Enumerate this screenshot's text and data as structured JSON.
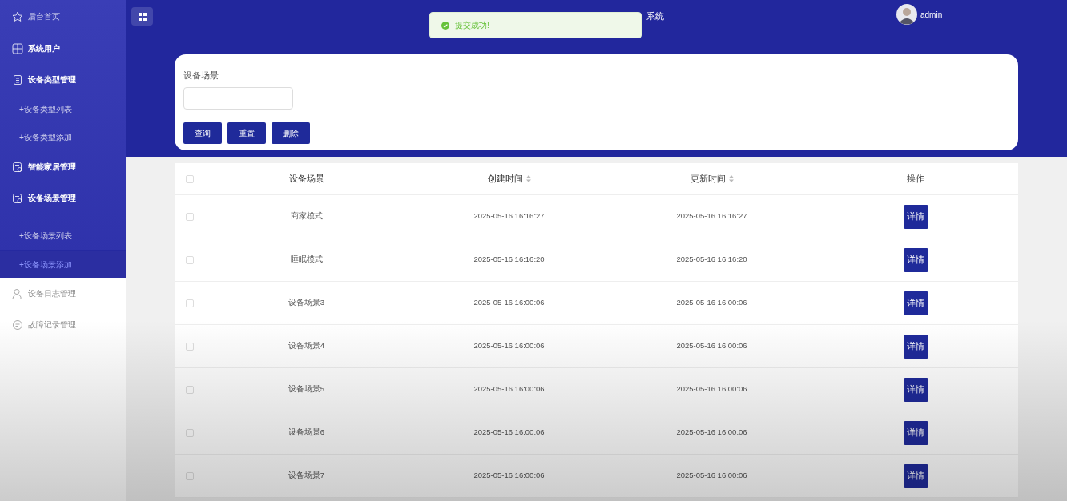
{
  "sidebar": {
    "items": [
      {
        "label": "后台首页"
      },
      {
        "label": "系统用户"
      },
      {
        "label": "设备类型管理",
        "children": [
          {
            "label": "+设备类型列表",
            "selected": false
          },
          {
            "label": "+设备类型添加",
            "selected": false
          }
        ]
      },
      {
        "label": "智能家居管理"
      },
      {
        "label": "设备场景管理",
        "children": [
          {
            "label": "+设备场景列表",
            "selected": false
          },
          {
            "label": "+设备场景添加",
            "selected": true
          }
        ]
      },
      {
        "label": "设备日志管理"
      },
      {
        "label": "故障记录管理"
      }
    ]
  },
  "header": {
    "title": "系统",
    "user": "admin"
  },
  "toast": {
    "message": "提交成功!"
  },
  "search": {
    "label": "设备场景",
    "buttons": [
      "查询",
      "重置",
      "删除"
    ]
  },
  "table": {
    "all_checked": false,
    "columns": [
      {
        "label": "设备场景",
        "sortable": false
      },
      {
        "label": "创建时间",
        "sortable": true
      },
      {
        "label": "更新时间",
        "sortable": true
      },
      {
        "label": "操作",
        "sortable": false
      }
    ],
    "rows": [
      {
        "checked": false,
        "cells": [
          "商家模式",
          "2025-05-16 16:16:27",
          "2025-05-16 16:16:27"
        ],
        "action": "详情"
      },
      {
        "checked": false,
        "cells": [
          "睡眠模式",
          "2025-05-16 16:16:20",
          "2025-05-16 16:16:20"
        ],
        "action": "详情"
      },
      {
        "checked": false,
        "cells": [
          "设备场景3",
          "2025-05-16 16:00:06",
          "2025-05-16 16:00:06"
        ],
        "action": "详情"
      },
      {
        "checked": false,
        "cells": [
          "设备场景4",
          "2025-05-16 16:00:06",
          "2025-05-16 16:00:06"
        ],
        "action": "详情"
      },
      {
        "checked": false,
        "cells": [
          "设备场景5",
          "2025-05-16 16:00:06",
          "2025-05-16 16:00:06"
        ],
        "action": "详情"
      },
      {
        "checked": false,
        "cells": [
          "设备场景6",
          "2025-05-16 16:00:06",
          "2025-05-16 16:00:06"
        ],
        "action": "详情"
      },
      {
        "checked": false,
        "cells": [
          "设备场景7",
          "2025-05-16 16:00:06",
          "2025-05-16 16:00:06"
        ],
        "action": "详情"
      }
    ]
  }
}
